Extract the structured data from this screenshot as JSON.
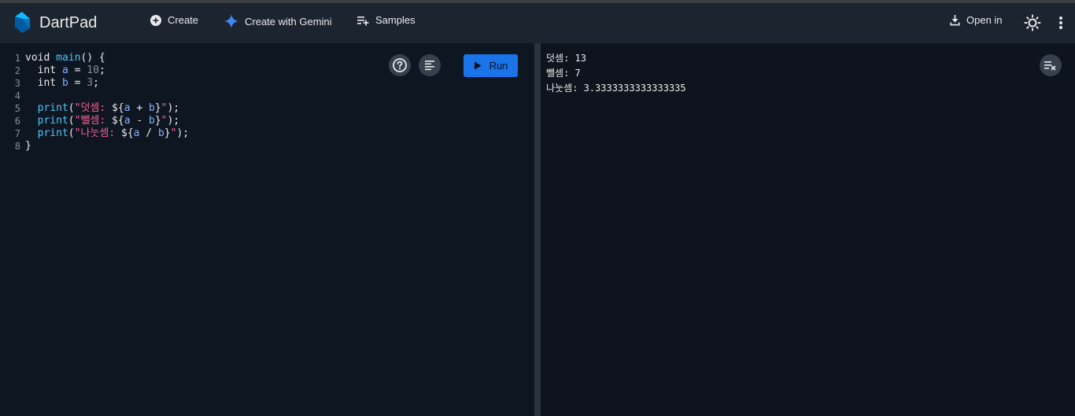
{
  "app": {
    "title": "DartPad"
  },
  "nav": {
    "create": "Create",
    "create_gemini": "Create with Gemini",
    "samples": "Samples",
    "open_in": "Open in"
  },
  "editor": {
    "run_label": "Run",
    "lines": [
      {
        "num": "1",
        "tokens": [
          {
            "t": "void ",
            "c": "kw"
          },
          {
            "t": "main",
            "c": "fn"
          },
          {
            "t": "() {",
            "c": "ct"
          }
        ]
      },
      {
        "num": "2",
        "tokens": [
          {
            "t": "  int ",
            "c": "kw"
          },
          {
            "t": "a",
            "c": "var"
          },
          {
            "t": " = ",
            "c": "ct"
          },
          {
            "t": "10",
            "c": "num"
          },
          {
            "t": ";",
            "c": "ct"
          }
        ]
      },
      {
        "num": "3",
        "tokens": [
          {
            "t": "  int ",
            "c": "kw"
          },
          {
            "t": "b",
            "c": "var"
          },
          {
            "t": " = ",
            "c": "ct"
          },
          {
            "t": "3",
            "c": "num"
          },
          {
            "t": ";",
            "c": "ct"
          }
        ]
      },
      {
        "num": "4",
        "tokens": []
      },
      {
        "num": "5",
        "tokens": [
          {
            "t": "  print",
            "c": "fn"
          },
          {
            "t": "(",
            "c": "ct"
          },
          {
            "t": "\"덧셈: ",
            "c": "str"
          },
          {
            "t": "${",
            "c": "ct"
          },
          {
            "t": "a",
            "c": "var"
          },
          {
            "t": " + ",
            "c": "ct"
          },
          {
            "t": "b",
            "c": "var"
          },
          {
            "t": "}",
            "c": "ct"
          },
          {
            "t": "\"",
            "c": "str"
          },
          {
            "t": ");",
            "c": "ct"
          }
        ]
      },
      {
        "num": "6",
        "tokens": [
          {
            "t": "  print",
            "c": "fn"
          },
          {
            "t": "(",
            "c": "ct"
          },
          {
            "t": "\"뺄셈: ",
            "c": "str"
          },
          {
            "t": "${",
            "c": "ct"
          },
          {
            "t": "a",
            "c": "var"
          },
          {
            "t": " - ",
            "c": "ct"
          },
          {
            "t": "b",
            "c": "var"
          },
          {
            "t": "}",
            "c": "ct"
          },
          {
            "t": "\"",
            "c": "str"
          },
          {
            "t": ");",
            "c": "ct"
          }
        ]
      },
      {
        "num": "7",
        "tokens": [
          {
            "t": "  print",
            "c": "fn"
          },
          {
            "t": "(",
            "c": "ct"
          },
          {
            "t": "\"나눗셈: ",
            "c": "str"
          },
          {
            "t": "${",
            "c": "ct"
          },
          {
            "t": "a",
            "c": "var"
          },
          {
            "t": " / ",
            "c": "ct"
          },
          {
            "t": "b",
            "c": "var"
          },
          {
            "t": "}",
            "c": "ct"
          },
          {
            "t": "\"",
            "c": "str"
          },
          {
            "t": ");",
            "c": "ct"
          }
        ]
      },
      {
        "num": "8",
        "tokens": [
          {
            "t": "}",
            "c": "ct"
          }
        ]
      }
    ]
  },
  "output": {
    "lines": [
      "덧셈: 13",
      "뺄셈: 7",
      "나눗셈: 3.3333333333333335"
    ]
  },
  "colors": {
    "accent": "#1a73e8",
    "gemini": "#4285f4"
  }
}
